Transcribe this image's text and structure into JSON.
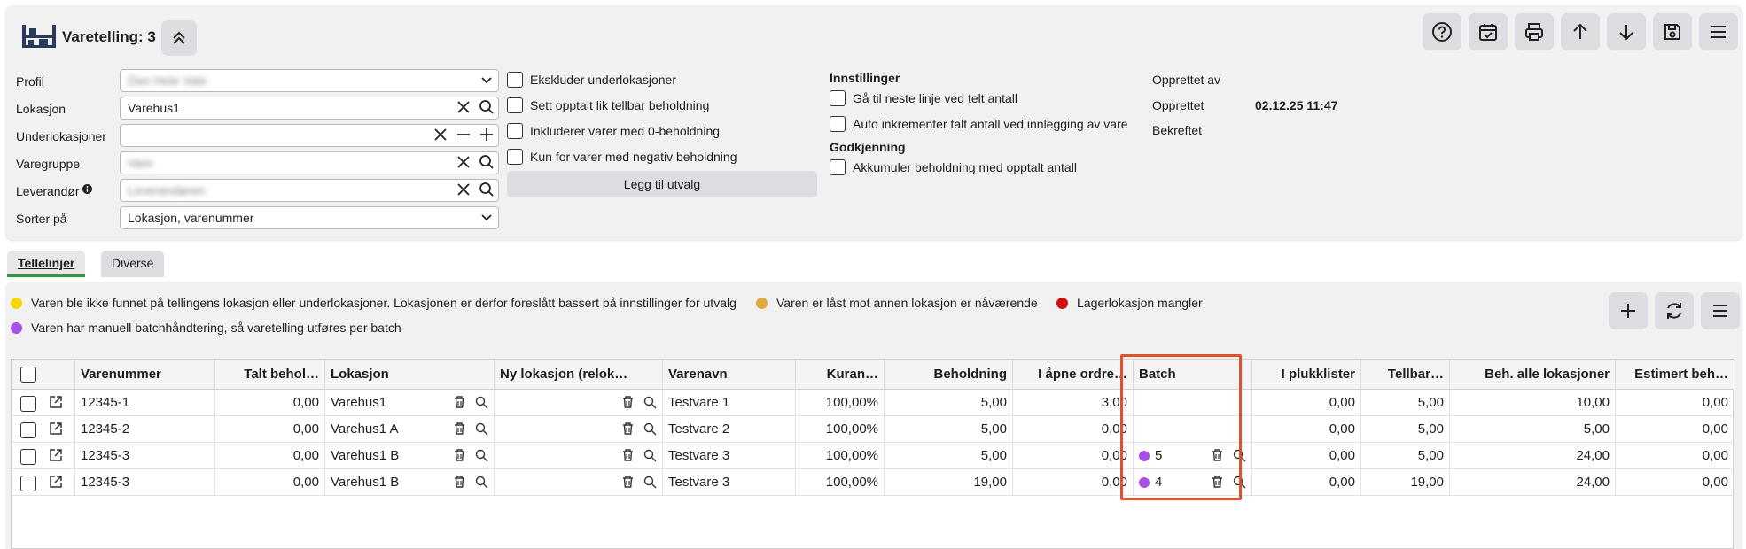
{
  "header": {
    "title": "Varetelling: 3"
  },
  "toolbar": [
    "help-icon",
    "calendar-check-icon",
    "print-icon",
    "arrow-up-icon",
    "arrow-down-icon",
    "save-icon",
    "menu-icon"
  ],
  "form": {
    "profil_label": "Profil",
    "profil_value": "Den Hele Vale",
    "lokasjon_label": "Lokasjon",
    "lokasjon_value": "Varehus1",
    "underlok_label": "Underlokasjoner",
    "underlok_value": "",
    "varegruppe_label": "Varegruppe",
    "varegruppe_value": "Vare",
    "leverandor_label": "Leverandør",
    "leverandor_value": "Leverandøren",
    "sorter_label": "Sorter på",
    "sorter_value": "Lokasjon, varenummer"
  },
  "options": {
    "ekskluder": "Ekskluder underlokasjoner",
    "sett_opptalt": "Sett opptalt lik tellbar beholdning",
    "inkluder_null": "Inkluderer varer med 0-beholdning",
    "kun_negativ": "Kun for varer med negativ beholdning",
    "legg_til": "Legg til utvalg"
  },
  "settings": {
    "title": "Innstillinger",
    "ga_neste": "Gå til neste linje ved telt antall",
    "auto_inkr": "Auto inkrementer talt antall ved innlegging av vare",
    "godkjenning": "Godkjenning",
    "akkumuler": "Akkumuler beholdning med opptalt antall"
  },
  "meta": {
    "opprettet_av_label": "Opprettet av",
    "opprettet_label": "Opprettet",
    "opprettet_value": "02.12.25 11:47",
    "bekreftet_label": "Bekreftet"
  },
  "tabs": {
    "tellelinjer": "Tellelinjer",
    "diverse": "Diverse"
  },
  "legend": {
    "yellow": "Varen ble ikke funnet på tellingens lokasjon eller underlokasjoner. Lokasjonen er derfor foreslått bassert på innstillinger for utvalg",
    "orange": "Varen er låst mot annen lokasjon er nåværende",
    "red": "Lagerlokasjon mangler",
    "purple": "Varen har manuell batchhåndtering, så varetelling utføres per batch",
    "colors": {
      "yellow": "#f5d600",
      "orange": "#e1aa3c",
      "red": "#d10f0f",
      "purple": "#a94ee6"
    }
  },
  "table": {
    "headers": {
      "varenummer": "Varenummer",
      "talt": "Talt behol…",
      "lokasjon": "Lokasjon",
      "ny_lokasjon": "Ny lokasjon (relok…",
      "varenavn": "Varenavn",
      "kurans": "Kuran…",
      "beholdning": "Beholdning",
      "apne": "I åpne ordre…",
      "batch": "Batch",
      "plukklister": "I plukklister",
      "tellbar": "Tellbar…",
      "beh_alle": "Beh. alle lokasjoner",
      "estimert": "Estimert beh…"
    },
    "rows": [
      {
        "varenummer": "12345-1",
        "talt": "0,00",
        "lokasjon": "Varehus1",
        "varenavn": "Testvare 1",
        "kurans": "100,00%",
        "beholdning": "5,00",
        "apne": "3,00",
        "batch": "",
        "plukklister": "0,00",
        "tellbar": "5,00",
        "beh_alle": "10,00",
        "estimert": "0,00"
      },
      {
        "varenummer": "12345-2",
        "talt": "0,00",
        "lokasjon": "Varehus1 A",
        "varenavn": "Testvare 2",
        "kurans": "100,00%",
        "beholdning": "5,00",
        "apne": "0,00",
        "batch": "",
        "plukklister": "0,00",
        "tellbar": "5,00",
        "beh_alle": "5,00",
        "estimert": "0,00"
      },
      {
        "varenummer": "12345-3",
        "talt": "0,00",
        "lokasjon": "Varehus1 B",
        "varenavn": "Testvare 3",
        "kurans": "100,00%",
        "beholdning": "5,00",
        "apne": "0,00",
        "batch": "5",
        "plukklister": "0,00",
        "tellbar": "5,00",
        "beh_alle": "24,00",
        "estimert": "0,00"
      },
      {
        "varenummer": "12345-3",
        "talt": "0,00",
        "lokasjon": "Varehus1 B",
        "varenavn": "Testvare 3",
        "kurans": "100,00%",
        "beholdning": "19,00",
        "apne": "0,00",
        "batch": "4",
        "plukklister": "0,00",
        "tellbar": "19,00",
        "beh_alle": "24,00",
        "estimert": "0,00"
      }
    ]
  }
}
